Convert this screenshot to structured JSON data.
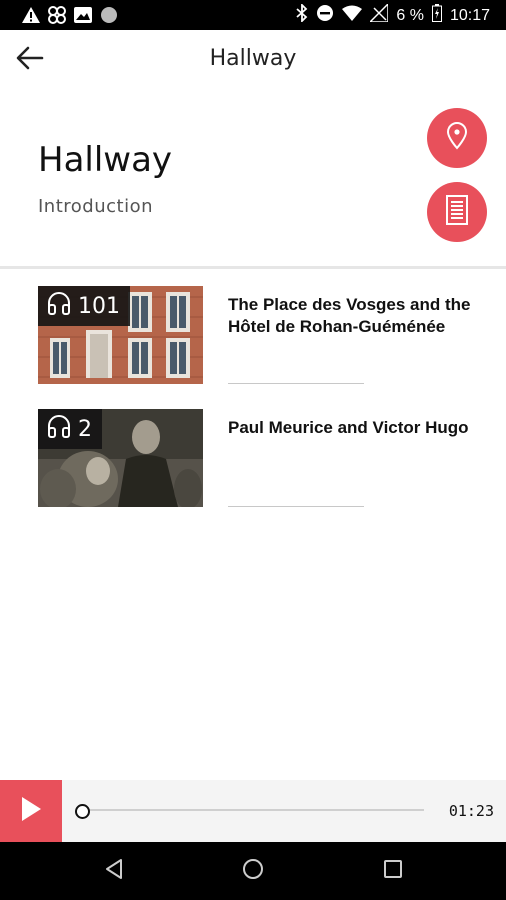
{
  "status_bar": {
    "battery": "6 %",
    "time": "10:17",
    "left_icons": [
      "warning-icon",
      "fan-icon",
      "image-icon",
      "circle-icon"
    ],
    "right_icons": [
      "bluetooth-icon",
      "do-not-disturb-icon",
      "wifi-icon",
      "no-signal-icon",
      "battery-charging-icon"
    ]
  },
  "app_bar": {
    "title": "Hallway",
    "back_icon": "arrow-left-icon"
  },
  "header": {
    "title": "Hallway",
    "subtitle": "Introduction",
    "map_icon": "location-pin-icon",
    "text_icon": "document-icon",
    "accent_color": "#e8505b"
  },
  "items": [
    {
      "number": "101",
      "title": "The Place des Vosges and the Hôtel de Rohan-Guéménée",
      "icon": "headphones-icon"
    },
    {
      "number": "2",
      "title": "Paul Meurice and Victor Hugo",
      "icon": "headphones-icon"
    }
  ],
  "player": {
    "time": "01:23",
    "progress": 0.0,
    "play_icon": "play-icon"
  },
  "nav_bar": {
    "icons": [
      "back-triangle-icon",
      "home-circle-icon",
      "recents-square-icon"
    ]
  }
}
